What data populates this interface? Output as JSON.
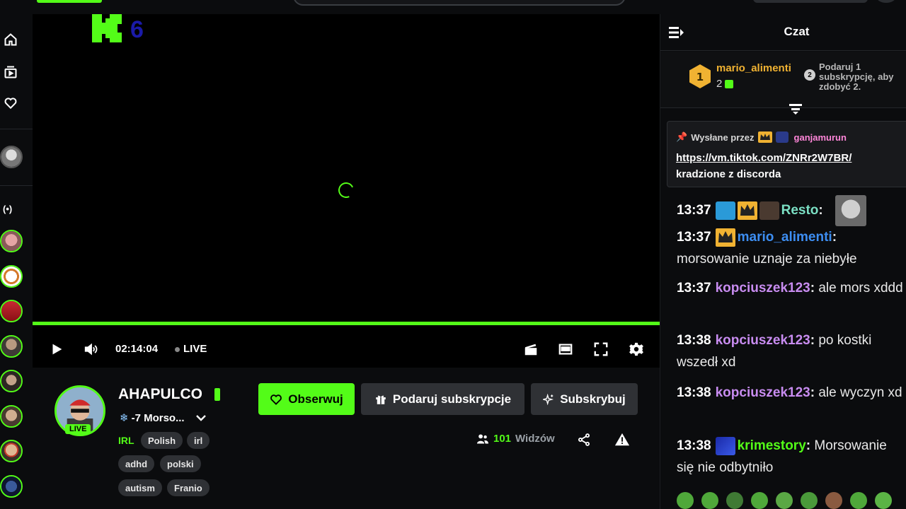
{
  "player": {
    "overlay_number": "6",
    "time": "02:14:04",
    "live_label": "LIVE"
  },
  "channel": {
    "name": "AHAPULCO",
    "live_badge": "LIVE",
    "stream_title": "-7 Morso...",
    "category": "IRL",
    "tags": [
      "Polish",
      "irl",
      "adhd",
      "polski",
      "autism",
      "Franio"
    ]
  },
  "actions": {
    "follow": "Obserwuj",
    "gift": "Podaruj subskrypcje",
    "subscribe": "Subskrybuj"
  },
  "viewers": {
    "count": "101",
    "label": "Widzów"
  },
  "chat": {
    "title": "Czat",
    "leaderboard": {
      "rank": "1",
      "name": "mario_alimenti",
      "count": "2",
      "next_rank": "2",
      "next_text": "Podaruj 1 subskrypcję, aby zdobyć 2."
    },
    "pinned": {
      "sent_by": "Wysłane przez",
      "user": "ganjamurun",
      "link": "https://vm.tiktok.com/ZNRr2W7BR/",
      "text": "kradzione z discorda"
    },
    "messages": [
      {
        "time": "13:37",
        "user": "Resto",
        "color": "#7be0c4",
        "text": ""
      },
      {
        "time": "13:37",
        "user": "mario_alimenti",
        "color": "#3d8ef2",
        "text": "morsowanie uznaje za niebyłe"
      },
      {
        "time": "13:37",
        "user": "kopciuszek123",
        "color": "#c88cf0",
        "text": "ale mors xddd"
      },
      {
        "time": "13:38",
        "user": "kopciuszek123",
        "color": "#c88cf0",
        "text": "po kostki wszedł xd"
      },
      {
        "time": "13:38",
        "user": "kopciuszek123",
        "color": "#c88cf0",
        "text": "ale wyczyn xd"
      },
      {
        "time": "13:38",
        "user": "krimestory",
        "color": "#53fc18",
        "text": "Morsowanie się nie odbytniło"
      }
    ]
  },
  "colors": {
    "accent": "#53fc18",
    "gold": "#f0b232"
  }
}
